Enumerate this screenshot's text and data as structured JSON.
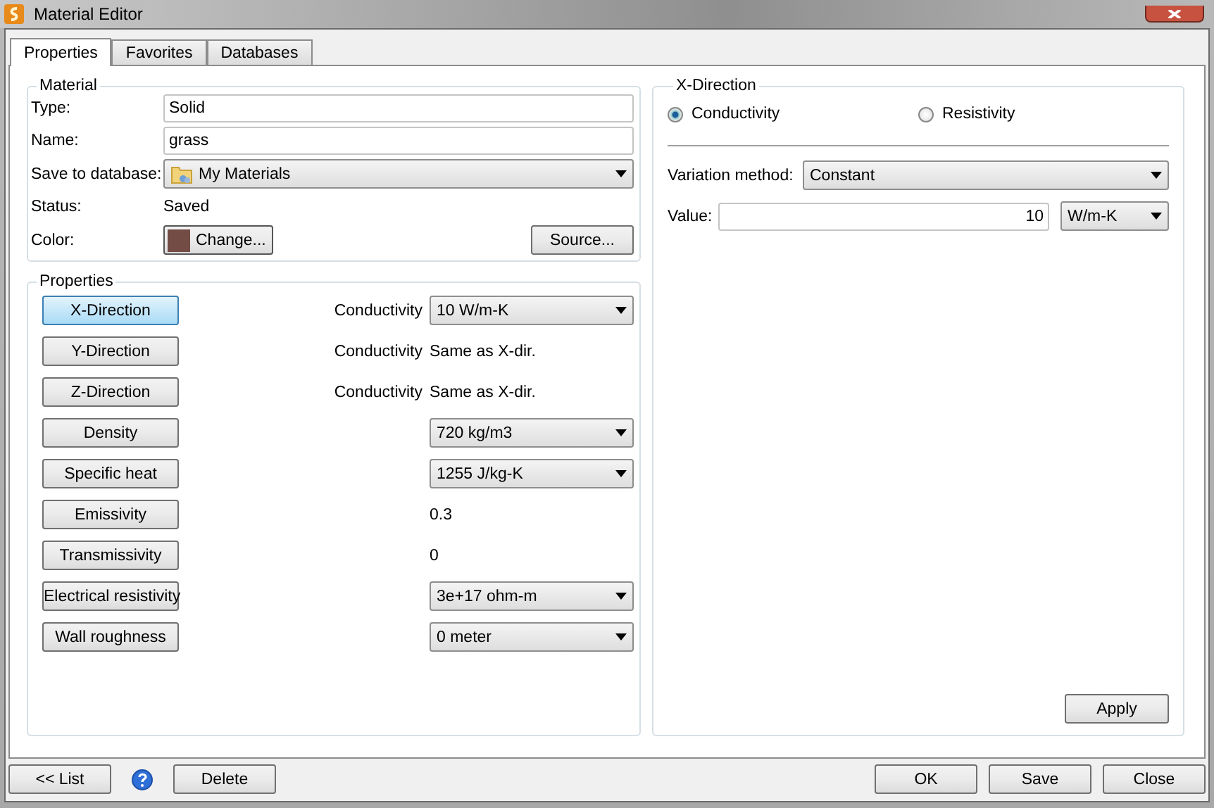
{
  "window": {
    "title": "Material Editor"
  },
  "tabs": [
    {
      "label": "Properties",
      "selected": true
    },
    {
      "label": "Favorites",
      "selected": false
    },
    {
      "label": "Databases",
      "selected": false
    }
  ],
  "material": {
    "title": "Material",
    "type_label": "Type:",
    "type_value": "Solid",
    "name_label": "Name:",
    "name_value": "grass",
    "db_label": "Save to database:",
    "db_value": "My Materials",
    "status_label": "Status:",
    "status_value": "Saved",
    "color_label": "Color:",
    "color": "#734c45",
    "change_button": "Change...",
    "source_button": "Source..."
  },
  "properties": {
    "title": "Properties",
    "rows": [
      {
        "button": "X-Direction",
        "selected": true,
        "label": "Conductivity",
        "kind": "dropdown",
        "value": "10 W/m-K"
      },
      {
        "button": "Y-Direction",
        "selected": false,
        "label": "Conductivity",
        "kind": "text",
        "value": "Same as X-dir."
      },
      {
        "button": "Z-Direction",
        "selected": false,
        "label": "Conductivity",
        "kind": "text",
        "value": "Same as X-dir."
      },
      {
        "button": "Density",
        "selected": false,
        "kind": "dropdown",
        "value": "720 kg/m3"
      },
      {
        "button": "Specific heat",
        "selected": false,
        "kind": "dropdown",
        "value": "1255 J/kg-K"
      },
      {
        "button": "Emissivity",
        "selected": false,
        "kind": "text",
        "value": "0.3"
      },
      {
        "button": "Transmissivity",
        "selected": false,
        "kind": "text",
        "value": "0"
      },
      {
        "button": "Electrical resistivity",
        "selected": false,
        "kind": "dropdown",
        "value": "3e+17 ohm-m"
      },
      {
        "button": "Wall roughness",
        "selected": false,
        "kind": "dropdown",
        "value": "0 meter"
      }
    ]
  },
  "direction": {
    "title": "X-Direction",
    "options": [
      {
        "label": "Conductivity",
        "selected": true
      },
      {
        "label": "Resistivity",
        "selected": false
      }
    ],
    "variation_label": "Variation method:",
    "variation_value": "Constant",
    "value_label": "Value:",
    "value": "10",
    "unit": "W/m-K",
    "apply_button": "Apply"
  },
  "footer": {
    "left_buttons": [
      "<< List",
      "Delete"
    ],
    "right_buttons": [
      "OK",
      "Save",
      "Close"
    ]
  }
}
